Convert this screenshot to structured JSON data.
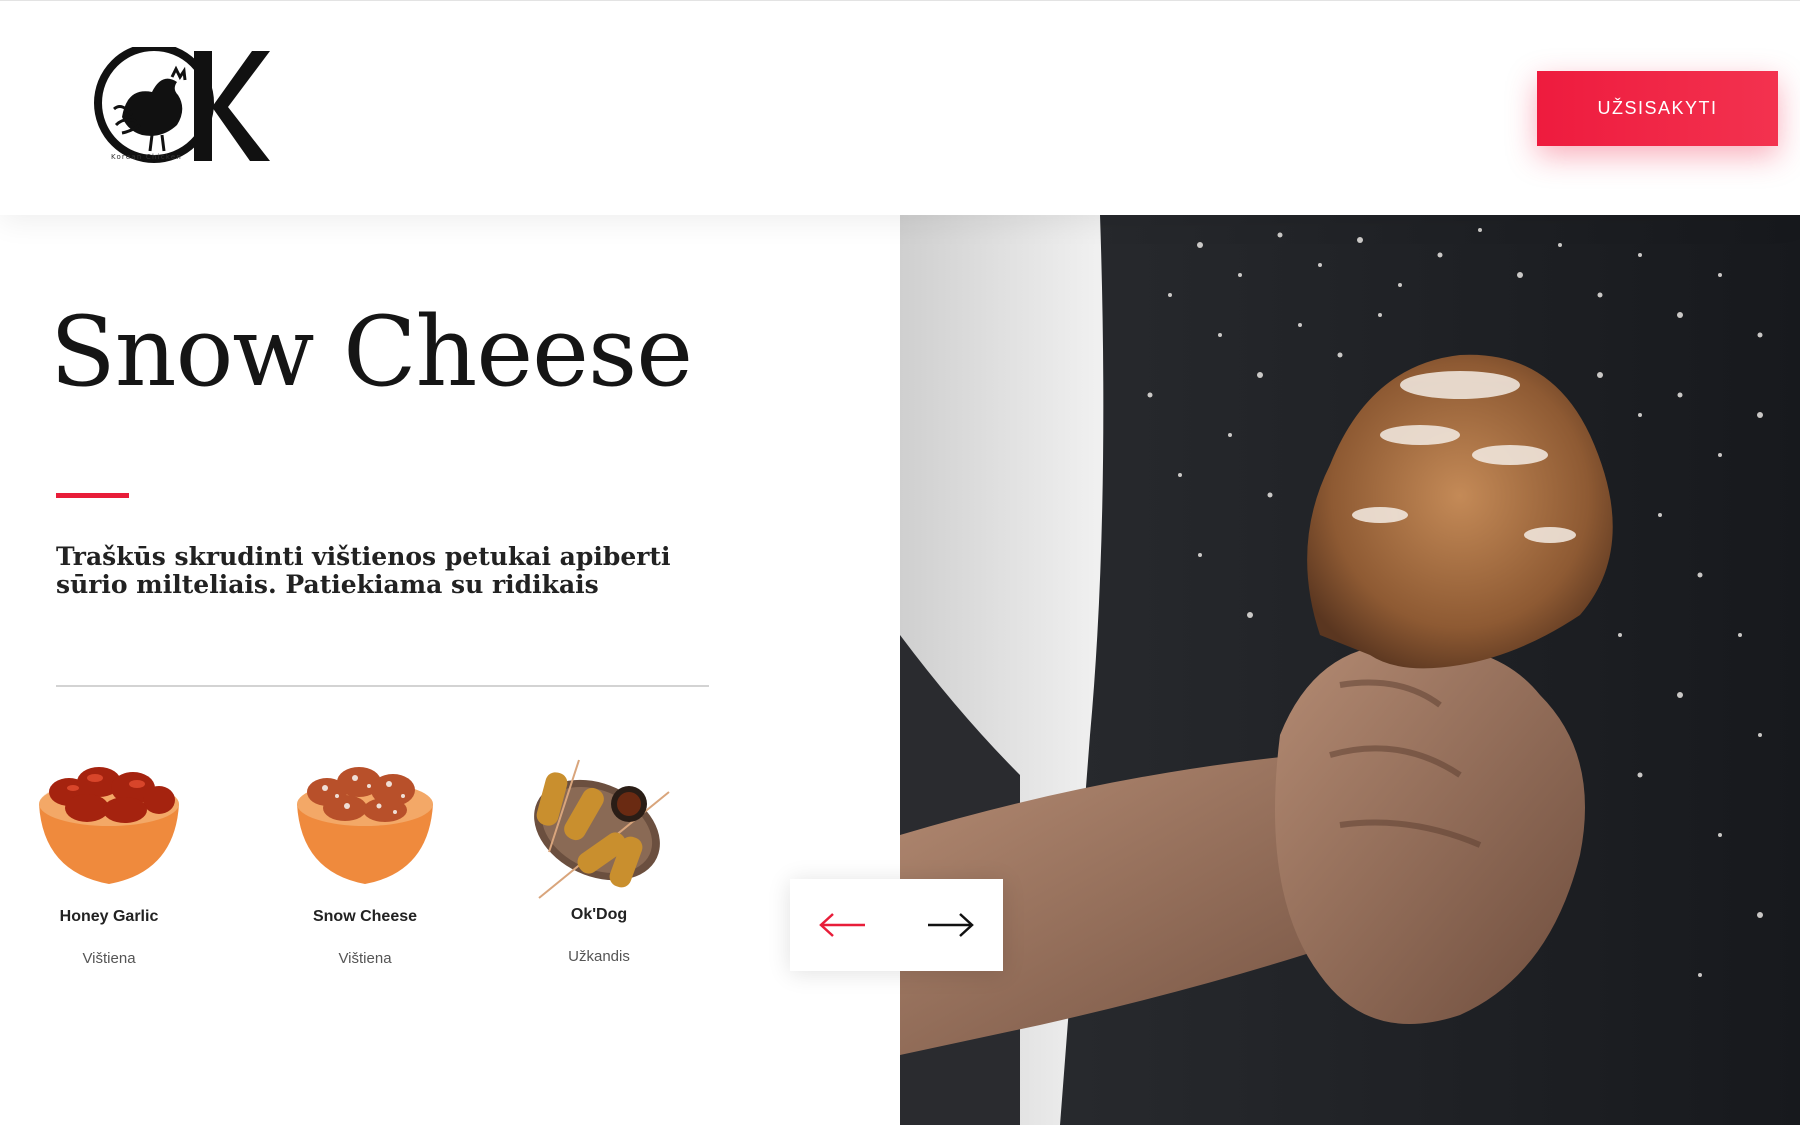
{
  "header": {
    "logo_text": "OK",
    "logo_caption": "Korean Chicken",
    "order_button": "UŽSISAKYTI"
  },
  "hero": {
    "title": "Snow Cheese",
    "description": "Traškūs skrudinti vištienos petukai apiberti sūrio milteliais. Patiekiama su ridikais"
  },
  "menu_items": [
    {
      "name": "Honey Garlic",
      "category": "Vištiena"
    },
    {
      "name": "Snow Cheese",
      "category": "Vištiena"
    },
    {
      "name": "Ok'Dog",
      "category": "Užkandis"
    }
  ],
  "slider": {
    "prev_icon": "arrow-left-icon",
    "next_icon": "arrow-right-icon"
  },
  "colors": {
    "accent": "#ee1b3e",
    "text_dark": "#151515",
    "hero_bg": "#1c1e22"
  }
}
